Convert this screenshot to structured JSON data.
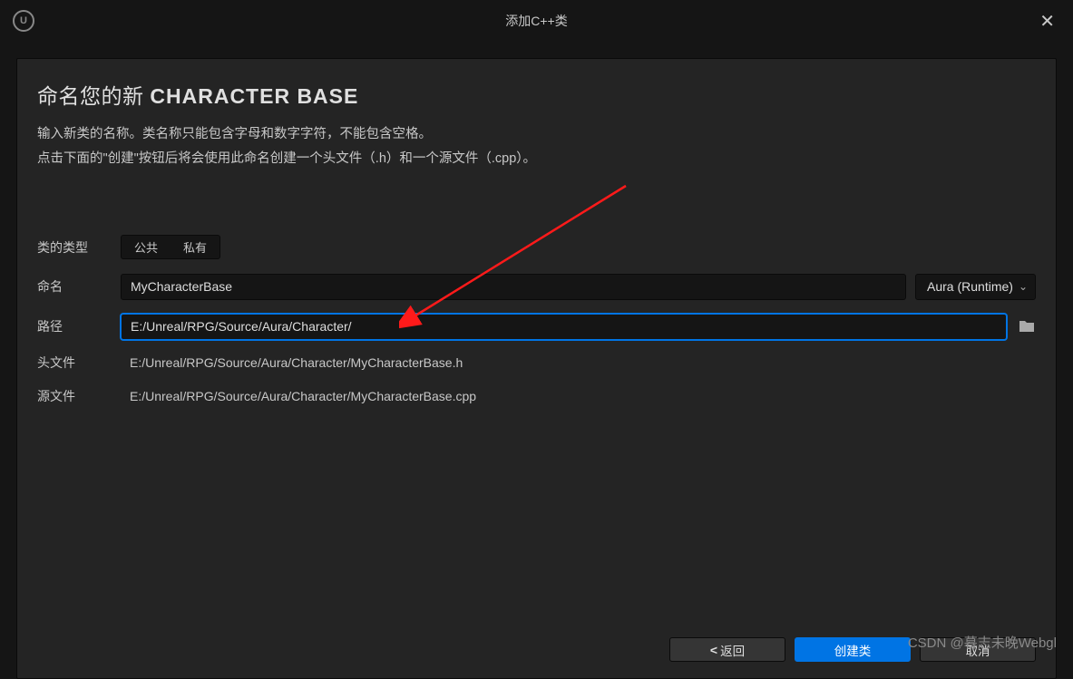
{
  "titlebar": {
    "title": "添加C++类"
  },
  "header": {
    "prefix": "命名您的新 ",
    "classname": "CHARACTER BASE",
    "desc_line1": "输入新类的名称。类名称只能包含字母和数字字符，不能包含空格。",
    "desc_line2": "点击下面的\"创建\"按钮后将会使用此命名创建一个头文件（.h）和一个源文件（.cpp）。"
  },
  "form": {
    "class_type_label": "类的类型",
    "public_label": "公共",
    "private_label": "私有",
    "name_label": "命名",
    "name_value": "MyCharacterBase",
    "module_value": "Aura (Runtime)",
    "path_label": "路径",
    "path_value": "E:/Unreal/RPG/Source/Aura/Character/",
    "header_label": "头文件",
    "header_value": "E:/Unreal/RPG/Source/Aura/Character/MyCharacterBase.h",
    "source_label": "源文件",
    "source_value": "E:/Unreal/RPG/Source/Aura/Character/MyCharacterBase.cpp"
  },
  "footer": {
    "back": "返回",
    "create": "创建类",
    "cancel": "取消"
  },
  "watermark": "CSDN @暮志未晚Webgl"
}
